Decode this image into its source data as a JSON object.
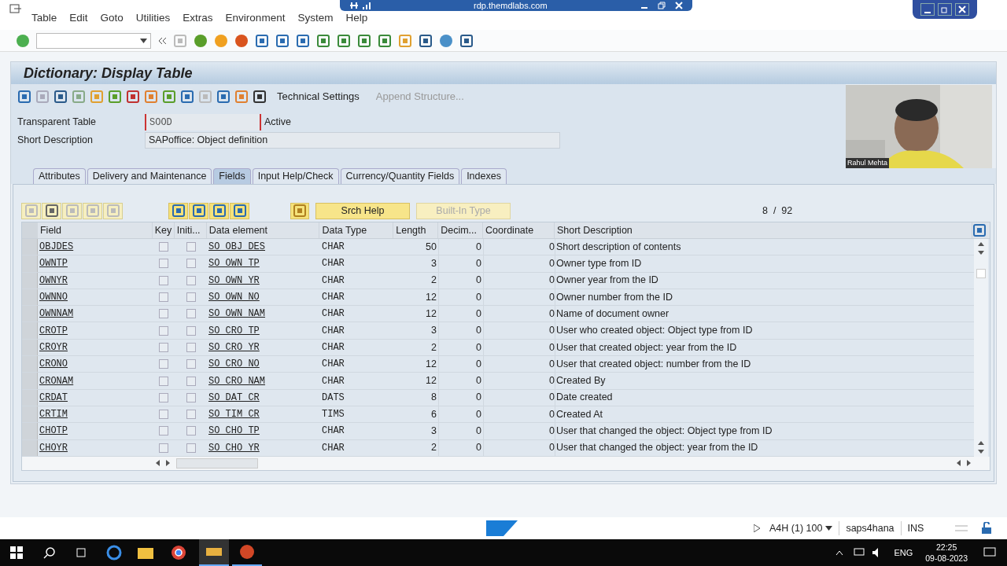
{
  "rdp_bar": {
    "title": "rdp.themdlabs.com"
  },
  "menu": [
    "Table",
    "Edit",
    "Goto",
    "Utilities",
    "Extras",
    "Environment",
    "System",
    "Help"
  ],
  "title": "Dictionary: Display Table",
  "app_toolbar": [
    {
      "label": "Technical Settings",
      "disabled": false
    },
    {
      "label": "Append Structure...",
      "disabled": true
    }
  ],
  "header_fields": [
    {
      "label": "Transparent Table",
      "value": "SOOD",
      "status": "Active",
      "kind": "short"
    },
    {
      "label": "Short Description",
      "value": "SAPoffice: Object definition",
      "kind": "long"
    }
  ],
  "video": {
    "caption": "Rahul Mehta"
  },
  "tabs": [
    {
      "label": "Attributes",
      "selected": false
    },
    {
      "label": "Delivery and Maintenance",
      "selected": false
    },
    {
      "label": "Fields",
      "selected": true
    },
    {
      "label": "Input Help/Check",
      "selected": false
    },
    {
      "label": "Currency/Quantity Fields",
      "selected": false
    },
    {
      "label": "Indexes",
      "selected": false
    }
  ],
  "table_buttons": [
    {
      "label": "Srch Help",
      "disabled": false
    },
    {
      "label": "Built-In Type",
      "disabled": true
    }
  ],
  "counter": "8  /  92",
  "table": {
    "columns": [
      "Field",
      "Key",
      "Initi...",
      "Data element",
      "Data Type",
      "Length",
      "Decim...",
      "Coordinate",
      "Short Description"
    ],
    "rows": [
      {
        "field": "OBJDES",
        "key": false,
        "initial": false,
        "data_element": "SO_OBJ_DES",
        "data_type": "CHAR",
        "length": "50",
        "decimals": "0",
        "coordinate": "0",
        "description": "Short description of contents"
      },
      {
        "field": "OWNTP",
        "key": false,
        "initial": false,
        "data_element": "SO_OWN_TP",
        "data_type": "CHAR",
        "length": "3",
        "decimals": "0",
        "coordinate": "0",
        "description": "Owner type from ID"
      },
      {
        "field": "OWNYR",
        "key": false,
        "initial": false,
        "data_element": "SO_OWN_YR",
        "data_type": "CHAR",
        "length": "2",
        "decimals": "0",
        "coordinate": "0",
        "description": "Owner year from the ID"
      },
      {
        "field": "OWNNO",
        "key": false,
        "initial": false,
        "data_element": "SO_OWN_NO",
        "data_type": "CHAR",
        "length": "12",
        "decimals": "0",
        "coordinate": "0",
        "description": "Owner number from the ID"
      },
      {
        "field": "OWNNAM",
        "key": false,
        "initial": false,
        "data_element": "SO_OWN_NAM",
        "data_type": "CHAR",
        "length": "12",
        "decimals": "0",
        "coordinate": "0",
        "description": "Name of document owner"
      },
      {
        "field": "CROTP",
        "key": false,
        "initial": false,
        "data_element": "SO_CRO_TP",
        "data_type": "CHAR",
        "length": "3",
        "decimals": "0",
        "coordinate": "0",
        "description": "User who created object: Object type from ID"
      },
      {
        "field": "CROYR",
        "key": false,
        "initial": false,
        "data_element": "SO_CRO_YR",
        "data_type": "CHAR",
        "length": "2",
        "decimals": "0",
        "coordinate": "0",
        "description": "User that created object: year from the ID"
      },
      {
        "field": "CRONO",
        "key": false,
        "initial": false,
        "data_element": "SO_CRO_NO",
        "data_type": "CHAR",
        "length": "12",
        "decimals": "0",
        "coordinate": "0",
        "description": "User that created object: number from the ID"
      },
      {
        "field": "CRONAM",
        "key": false,
        "initial": false,
        "data_element": "SO_CRO_NAM",
        "data_type": "CHAR",
        "length": "12",
        "decimals": "0",
        "coordinate": "0",
        "description": "Created By"
      },
      {
        "field": "CRDAT",
        "key": false,
        "initial": false,
        "data_element": "SO_DAT_CR",
        "data_type": "DATS",
        "length": "8",
        "decimals": "0",
        "coordinate": "0",
        "description": "Date created"
      },
      {
        "field": "CRTIM",
        "key": false,
        "initial": false,
        "data_element": "SO_TIM_CR",
        "data_type": "TIMS",
        "length": "6",
        "decimals": "0",
        "coordinate": "0",
        "description": "Created At"
      },
      {
        "field": "CHOTP",
        "key": false,
        "initial": false,
        "data_element": "SO_CHO_TP",
        "data_type": "CHAR",
        "length": "3",
        "decimals": "0",
        "coordinate": "0",
        "description": "User that changed the object: Object type from ID"
      },
      {
        "field": "CHOYR",
        "key": false,
        "initial": false,
        "data_element": "SO_CHO_YR",
        "data_type": "CHAR",
        "length": "2",
        "decimals": "0",
        "coordinate": "0",
        "description": "User that changed the object: year from the ID"
      }
    ]
  },
  "status_bar": {
    "system": "A4H (1) 100",
    "server": "saps4hana",
    "mode": "INS"
  },
  "taskbar": {
    "language": "ENG",
    "time": "22:25",
    "date": "09-08-2023"
  }
}
